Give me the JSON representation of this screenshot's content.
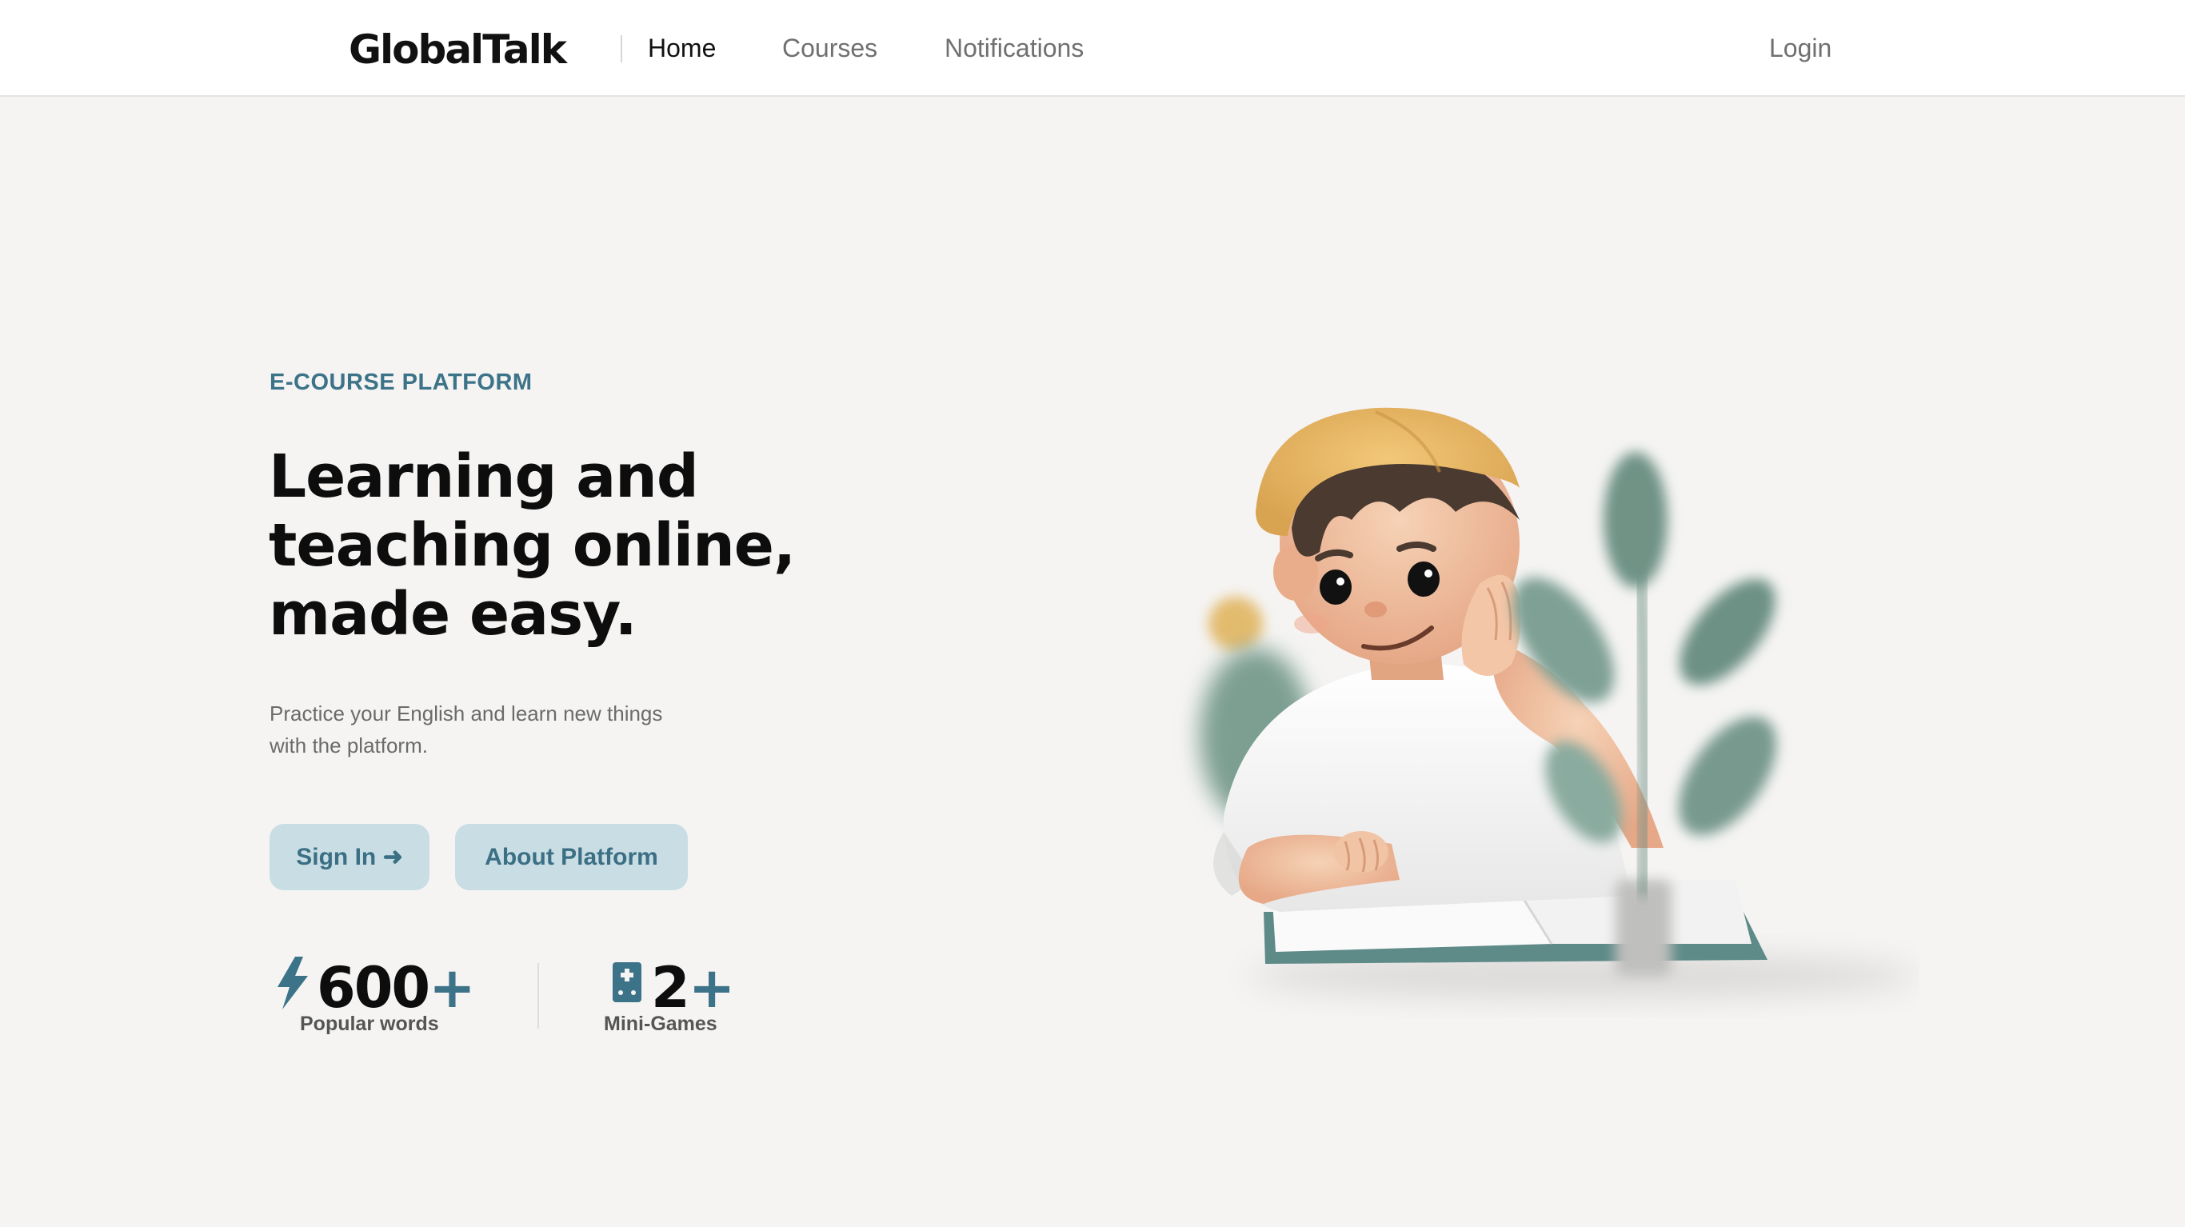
{
  "header": {
    "logo": "GlobalTalk",
    "nav": {
      "home": "Home",
      "courses": "Courses",
      "notifications": "Notifications"
    },
    "login": "Login"
  },
  "hero": {
    "eyebrow": "E-COURSE PLATFORM",
    "headline_line1": "Learning and",
    "headline_line2": "teaching online,",
    "headline_line3": "made easy.",
    "subtitle_line1": "Practice your English and learn new things",
    "subtitle_line2": "with the platform.",
    "buttons": {
      "sign_in": "Sign In ➜",
      "about": "About Platform"
    },
    "stats": [
      {
        "number": "600",
        "suffix": "+",
        "label": "Popular words",
        "icon": "lightning-icon"
      },
      {
        "number": "2",
        "suffix": "+",
        "label": "Mini-Games",
        "icon": "game-card-icon"
      }
    ]
  },
  "colors": {
    "accent": "#3c7388",
    "button_bg": "#c9dde4",
    "page_bg": "#f5f4f3",
    "headline": "#0d0d0d"
  }
}
